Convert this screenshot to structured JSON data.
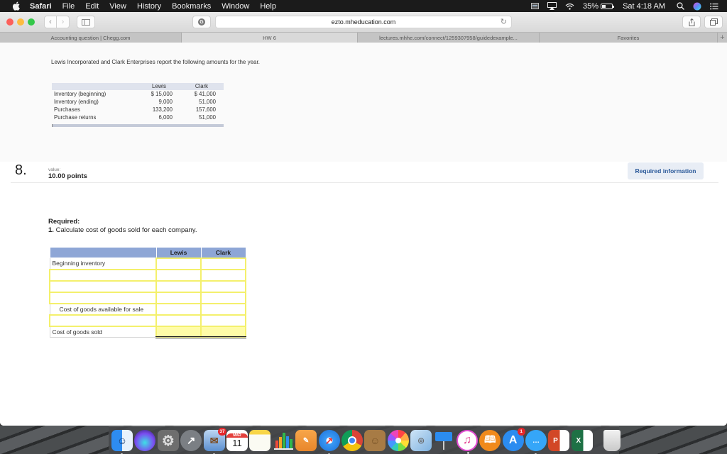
{
  "menubar": {
    "app_name": "Safari",
    "items": [
      "File",
      "Edit",
      "View",
      "History",
      "Bookmarks",
      "Window",
      "Help"
    ],
    "status": {
      "battery_percent": "35%",
      "battery_level": 0.35,
      "clock": "Sat 4:18 AM"
    },
    "icons": [
      "apple-icon",
      "screen-recorder-icon",
      "airplay-icon",
      "wifi-icon",
      "battery-icon",
      "spotlight-search-icon",
      "siri-icon",
      "notification-center-icon"
    ]
  },
  "browser": {
    "address": "ezto.mheducation.com",
    "tabs": [
      {
        "label": "Accounting question | Chegg.com",
        "active": false
      },
      {
        "label": "HW 6",
        "active": true
      },
      {
        "label": "lectures.mhhe.com/connect/1259307958/guidedexample...",
        "active": false
      },
      {
        "label": "Favorites",
        "active": false
      }
    ],
    "new_tab_label": "+"
  },
  "problem": {
    "intro": "Lewis Incorporated and Clark Enterprises report the following amounts for the year.",
    "given_table": {
      "columns": [
        "",
        "Lewis",
        "Clark"
      ],
      "rows": [
        [
          "Inventory (beginning)",
          "$ 15,000",
          "$ 41,000"
        ],
        [
          "Inventory (ending)",
          "9,000",
          "51,000"
        ],
        [
          "Purchases",
          "133,200",
          "157,600"
        ],
        [
          "Purchase returns",
          "6,000",
          "51,000"
        ]
      ]
    },
    "question_number": "8.",
    "value_label": "value:",
    "points": "10.00 points",
    "required_info_button": "Required information",
    "required_title": "Required:",
    "required_num": "1.",
    "required_text": " Calculate cost of goods sold for each company.",
    "work_table": {
      "columns": [
        "",
        "Lewis",
        "Clark"
      ],
      "rows": [
        {
          "label": "Beginning inventory",
          "lewis": "",
          "clark": ""
        },
        {
          "label": "",
          "lewis": "",
          "clark": ""
        },
        {
          "label": "",
          "lewis": "",
          "clark": ""
        },
        {
          "label": "",
          "lewis": "",
          "clark": ""
        },
        {
          "label": "Cost of goods available for sale",
          "lewis": "",
          "clark": ""
        },
        {
          "label": "",
          "lewis": "",
          "clark": ""
        },
        {
          "label": "Cost of goods sold",
          "lewis": "",
          "clark": ""
        }
      ]
    }
  },
  "dock": {
    "apps": [
      {
        "name": "Finder",
        "running": true
      },
      {
        "name": "Siri",
        "running": false
      },
      {
        "name": "System Preferences",
        "running": false
      },
      {
        "name": "Launchpad",
        "running": false
      },
      {
        "name": "Mail",
        "running": true,
        "badge": "37"
      },
      {
        "name": "Calendar",
        "running": false,
        "month": "MAR",
        "day": "11"
      },
      {
        "name": "Notes",
        "running": false
      },
      {
        "name": "Numbers",
        "running": false
      },
      {
        "name": "Pages",
        "running": false
      },
      {
        "name": "Safari",
        "running": true
      },
      {
        "name": "Chrome",
        "running": false
      },
      {
        "name": "Contacts",
        "running": false
      },
      {
        "name": "Photos",
        "running": false
      },
      {
        "name": "Preview",
        "running": false
      },
      {
        "name": "Keynote",
        "running": false
      },
      {
        "name": "iTunes",
        "running": true
      },
      {
        "name": "iBooks",
        "running": false
      },
      {
        "name": "App Store",
        "running": false,
        "badge": "1"
      },
      {
        "name": "Messages",
        "running": true
      },
      {
        "name": "PowerPoint",
        "running": false,
        "letter": "P"
      },
      {
        "name": "Excel",
        "running": false,
        "letter": "X"
      },
      {
        "name": "Trash",
        "running": false
      }
    ]
  }
}
